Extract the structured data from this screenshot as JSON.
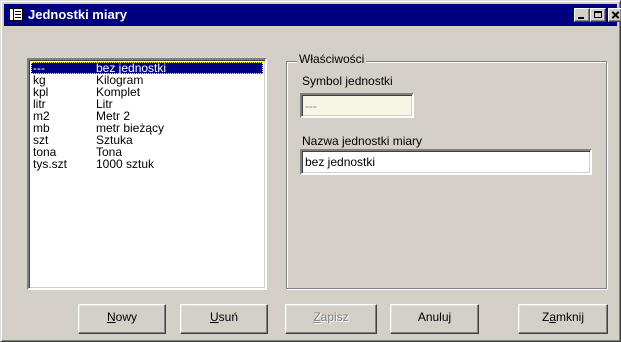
{
  "window": {
    "title": "Jednostki miary",
    "icon": "app-list-icon"
  },
  "units_list": [
    {
      "symbol": "---",
      "name": "bez jednostki",
      "selected": true
    },
    {
      "symbol": "kg",
      "name": "Kilogram"
    },
    {
      "symbol": "kpl",
      "name": "Komplet"
    },
    {
      "symbol": "litr",
      "name": "Litr"
    },
    {
      "symbol": "m2",
      "name": "Metr 2"
    },
    {
      "symbol": "mb",
      "name": "metr bieżący"
    },
    {
      "symbol": "szt",
      "name": "Sztuka"
    },
    {
      "symbol": "tona",
      "name": "Tona"
    },
    {
      "symbol": "tys.szt",
      "name": "1000 sztuk"
    }
  ],
  "properties": {
    "group_label": "Właściwości",
    "symbol_label": "Symbol jednostki",
    "symbol_value": "---",
    "name_label": "Nazwa jednostki miary",
    "name_value": "bez jednostki"
  },
  "buttons": {
    "new": {
      "hotkey": "N",
      "rest": "owy",
      "enabled": true
    },
    "delete": {
      "hotkey": "U",
      "rest": "suń",
      "enabled": true
    },
    "save": {
      "hotkey": "Z",
      "rest": "apisz",
      "enabled": false
    },
    "cancel": {
      "label": "Anuluj",
      "enabled": true
    },
    "close": {
      "pre": "Z",
      "hotkey": "a",
      "rest": "mknij",
      "enabled": true
    }
  },
  "colors": {
    "title_bar": "#000080",
    "face": "#d4d0c8",
    "selection": "#000080",
    "disabled_text": "#808080",
    "readonly_field": "#f7f5e4"
  }
}
